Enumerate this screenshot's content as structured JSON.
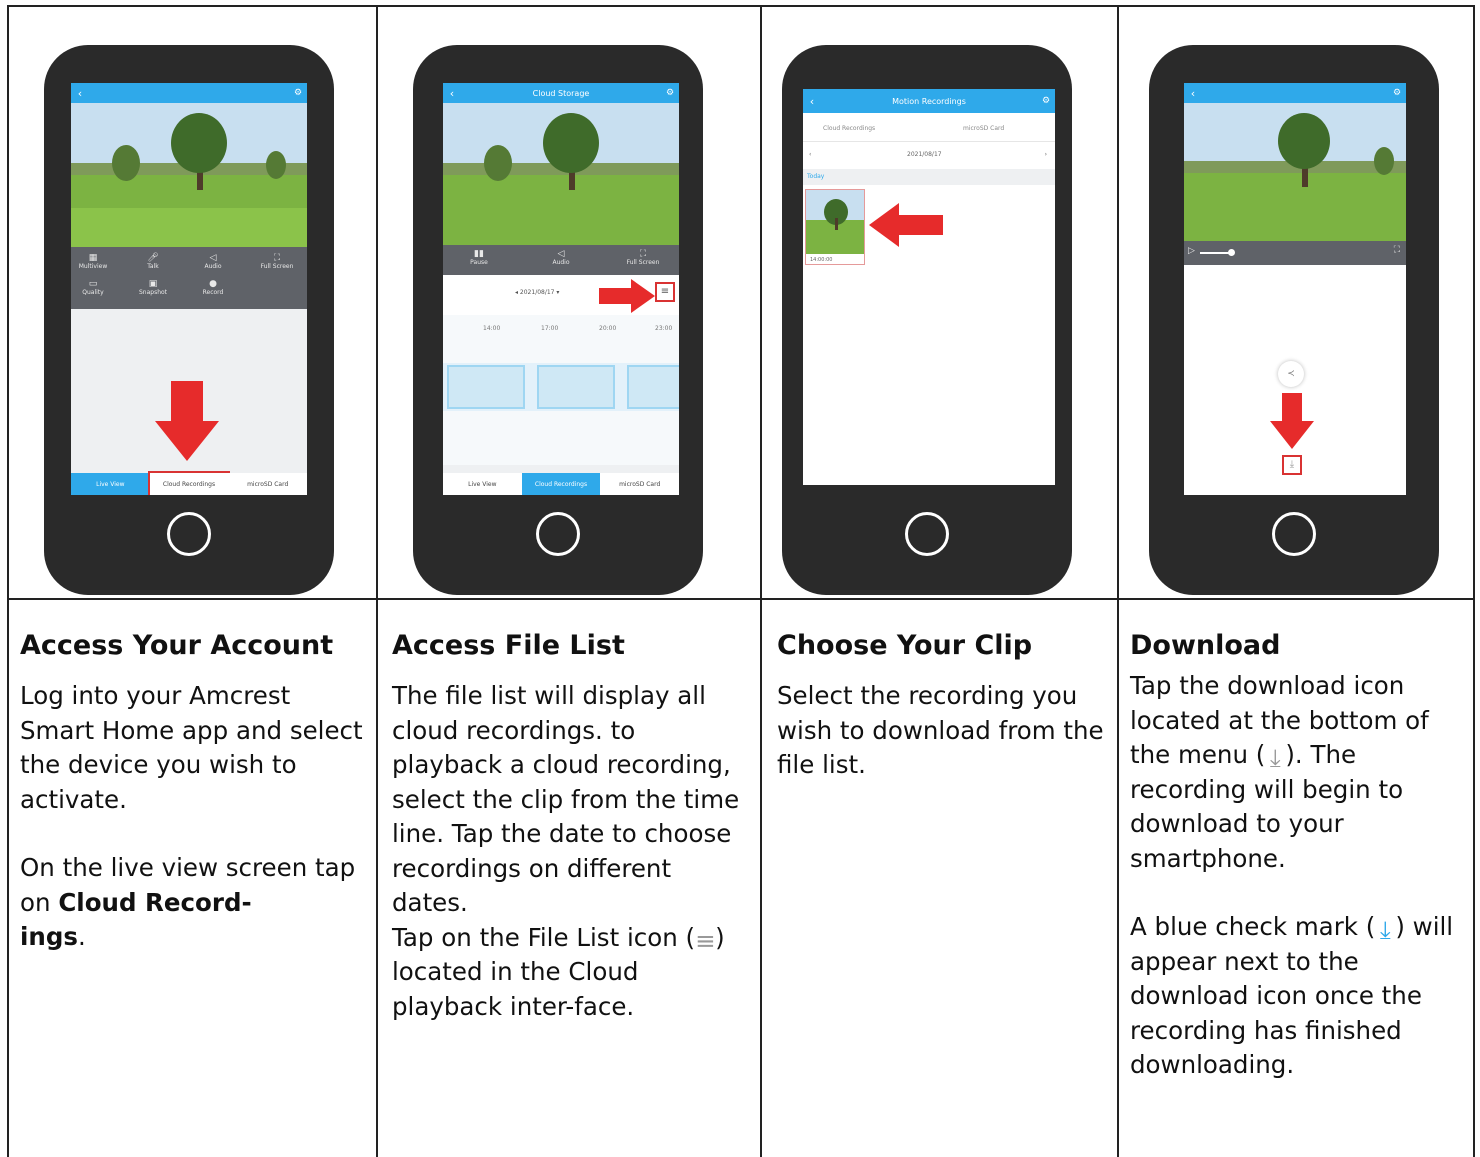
{
  "step1": {
    "heading": "Access Your Account",
    "body": "Log into your Amcrest Smart Home app and select the device you wish to activate.",
    "body2_prefix": "On the live view screen tap on ",
    "body2_bold_a": "Cloud Record-",
    "body2_bold_b": "ings",
    "body2_suffix": ".",
    "phone": {
      "controls": [
        "Multiview",
        "Talk",
        "Audio",
        "Full Screen",
        "Quality",
        "Snapshot",
        "Record"
      ],
      "tabs": [
        "Live View",
        "Cloud Recordings",
        "microSD Card"
      ]
    }
  },
  "step2": {
    "heading": "Access File List",
    "body": "The file list will display all cloud recordings. to playback a cloud recording, select the clip from the time line. Tap the date to choose recordings on different dates.",
    "body_b": "Tap on the File List icon (",
    "body_c": ") located in the Cloud playback inter-face.",
    "phone": {
      "title": "Cloud Storage",
      "controls": [
        "Pause",
        "Audio",
        "Full Screen"
      ],
      "date": "2021/08/17",
      "times": [
        "14:00",
        "17:00",
        "20:00",
        "23:00"
      ],
      "tabs": [
        "Live View",
        "Cloud Recordings",
        "microSD Card"
      ]
    }
  },
  "step3": {
    "heading": "Choose Your Clip",
    "body": "Select the recording you wish to download from the file list.",
    "phone": {
      "title": "Motion Recordings",
      "subtabs": [
        "Cloud Recordings",
        "microSD Card"
      ],
      "date": "2021/08/17",
      "group": "Today",
      "clip_time": "14:00:00"
    }
  },
  "step4": {
    "heading": "Download",
    "body": "Tap the download icon located at the bottom of the menu (",
    "body_tail": "). The recording will begin to download to your smartphone.",
    "body2": "A blue check mark (",
    "body2_tail": ") will appear next to the download icon once the recording has finished downloading."
  },
  "colors": {
    "accent": "#2fa9ea",
    "arrow": "#e62b2b",
    "phone": "#2a2a2a"
  },
  "icons": [
    "back-icon",
    "settings-icon",
    "down-arrow-icon",
    "right-arrow-icon",
    "left-arrow-icon",
    "download-icon",
    "file-list-icon",
    "share-icon",
    "home-button-icon"
  ]
}
